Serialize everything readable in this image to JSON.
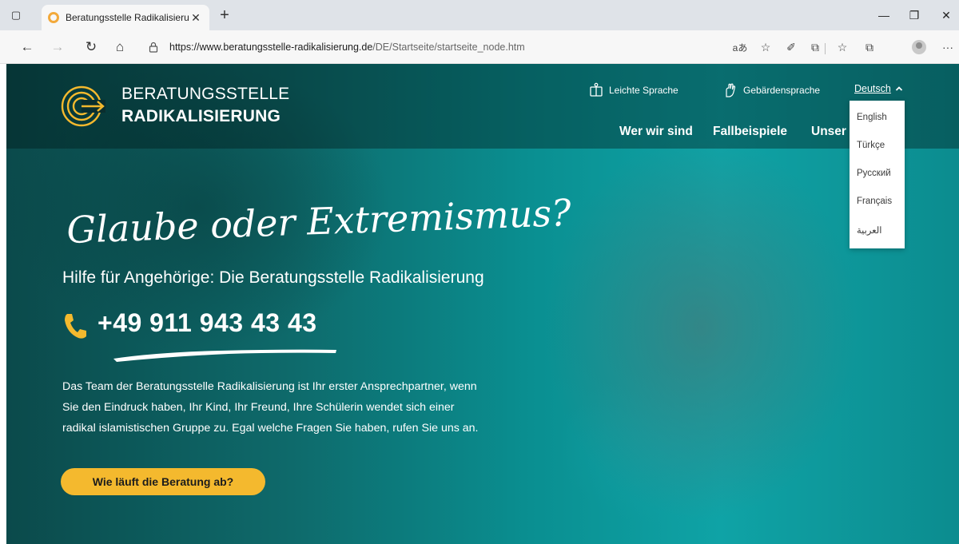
{
  "browser": {
    "tab_title": "Beratungsstelle Radikalisierung -",
    "url_host": "https://www.beratungsstelle-radikalisierung.de",
    "url_path": "/DE/Startseite/startseite_node.htm",
    "icons": [
      "tab-actions-icon",
      "close-tab-icon",
      "new-tab-icon",
      "minimize-icon",
      "restore-icon",
      "close-window-icon",
      "back-icon",
      "forward-icon",
      "refresh-icon",
      "home-icon",
      "site-info-icon",
      "read-aloud-icon",
      "add-favorite-icon",
      "browser-essentials-icon",
      "extensions-icon",
      "favorites-icon",
      "collections-icon",
      "profile-icon",
      "more-icon"
    ],
    "glyphs": {
      "tab_actions": "▢",
      "close_tab": "✕",
      "new_tab": "+",
      "minimize": "—",
      "restore": "❐",
      "close_window": "✕",
      "back": "←",
      "forward": "→",
      "refresh": "↻",
      "home": "⌂",
      "read_aloud": "aあ",
      "add_favorite": "☆",
      "essentials": "✐",
      "extensions": "⧉",
      "favorites": "☆",
      "collections": "⧉",
      "more": "···"
    }
  },
  "site": {
    "brand_top": "BERATUNGSSTELLE",
    "brand_bottom": "RADIKALISIERUNG",
    "easy_language": "Leichte Sprache",
    "sign_language": "Gebärdensprache",
    "current_language": "Deutsch",
    "languages": [
      "English",
      "Türkçe",
      "Русский",
      "Français",
      "العربية"
    ],
    "nav": [
      "Wer wir sind",
      "Fallbeispiele",
      "Unser"
    ],
    "hero_title": "Glaube oder Extremismus?",
    "subtitle": "Hilfe für Angehörige: Die Beratungsstelle Radikalisierung",
    "phone": "+49 911 943 43 43",
    "intro_lines": [
      "Das Team der Beratungsstelle Radikalisierung ist Ihr erster Ansprechpartner, wenn",
      "Sie den Eindruck haben, Ihr Kind, Ihr Freund, Ihre Schülerin wendet sich einer",
      "radikal islamistischen Gruppe zu. Egal welche Fragen Sie haben, rufen Sie uns an."
    ],
    "cta": "Wie läuft die Beratung ab?"
  },
  "colors": {
    "accent": "#f4b92e",
    "hero_teal": "#0a8f91",
    "dark_teal": "#0b4a4b",
    "text_on_dark": "#ffffff"
  }
}
